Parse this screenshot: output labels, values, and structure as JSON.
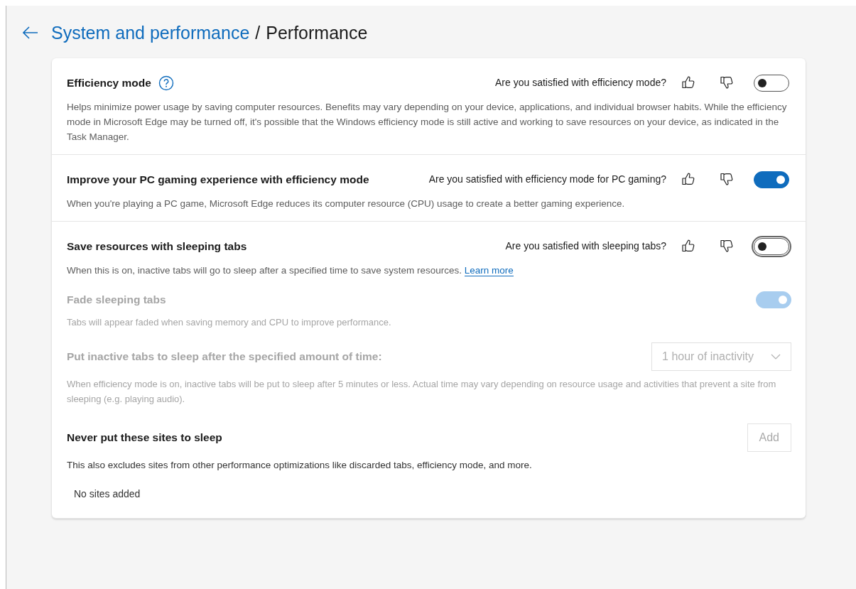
{
  "header": {
    "parent": "System and performance",
    "separator": "/",
    "current": "Performance"
  },
  "sections": [
    {
      "title": "Efficiency mode",
      "help": true,
      "question": "Are you satisfied with efficiency mode?",
      "toggle": {
        "on": false,
        "focused": false
      },
      "description": "Helps minimize power usage by saving computer resources. Benefits may vary depending on your device, applications, and individual browser habits. While the efficiency mode in Microsoft Edge may be turned off, it's possible that the Windows efficiency mode is still active and working to save resources on your device, as indicated in the Task Manager."
    },
    {
      "title": "Improve your PC gaming experience with efficiency mode",
      "help": false,
      "question": "Are you satisfied with efficiency mode for PC gaming?",
      "toggle": {
        "on": true,
        "focused": false
      },
      "description": "When you're playing a PC game, Microsoft Edge reduces its computer resource (CPU) usage to create a better gaming experience."
    },
    {
      "title": "Save resources with sleeping tabs",
      "help": false,
      "question": "Are you satisfied with sleeping tabs?",
      "toggle": {
        "on": false,
        "focused": true
      },
      "description": "When this is on, inactive tabs will go to sleep after a specified time to save system resources.",
      "link": "Learn more",
      "settings": [
        {
          "kind": "toggle",
          "title": "Fade sleeping tabs",
          "disabled": true,
          "on": true,
          "description": "Tabs will appear faded when saving memory and CPU to improve performance."
        },
        {
          "kind": "select",
          "title": "Put inactive tabs to sleep after the specified amount of time:",
          "disabled": true,
          "value": "1 hour of inactivity",
          "description": "When efficiency mode is on, inactive tabs will be put to sleep after 5 minutes or less. Actual time may vary depending on resource usage and activities that prevent a site from sleeping (e.g. playing audio)."
        },
        {
          "kind": "list",
          "title": "Never put these sites to sleep",
          "disabled": false,
          "button": {
            "label": "Add",
            "disabled": true
          },
          "description": "This also excludes sites from other performance optimizations like discarded tabs, efficiency mode, and more.",
          "empty": "No sites added"
        }
      ]
    }
  ]
}
